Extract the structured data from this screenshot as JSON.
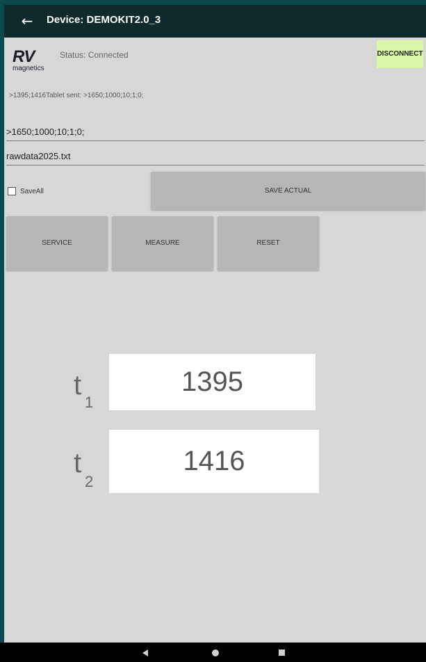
{
  "appbar": {
    "title": "Device: DEMOKIT2.0_3",
    "back_icon": "arrow-back-icon"
  },
  "brand": {
    "mark": "RV",
    "sub": "magnetics"
  },
  "status": "Status: Connected",
  "disconnect_label": "DISCONNECT",
  "log_line": ">1395;1416Tablet sent: >1650;1000;10;1;0;",
  "command_field": ">1650;1000;10;1;0;",
  "filename_field": "rawdata2025.txt",
  "saveall": {
    "label": "SaveAll",
    "checked": false
  },
  "buttons": {
    "save_actual": "SAVE ACTUAL",
    "service": "SERVICE",
    "measure": "MEASURE",
    "reset": "RESET"
  },
  "readings": [
    {
      "label": "t",
      "sub": "1",
      "value": "1395"
    },
    {
      "label": "t",
      "sub": "2",
      "value": "1416"
    }
  ],
  "colors": {
    "appbar": "#0e2a2c",
    "frame": "#0d4a4c",
    "content_bg": "#d7d7d7",
    "disconnect_bg": "#d9f7a6",
    "button_bg": "#b6b6b6"
  }
}
